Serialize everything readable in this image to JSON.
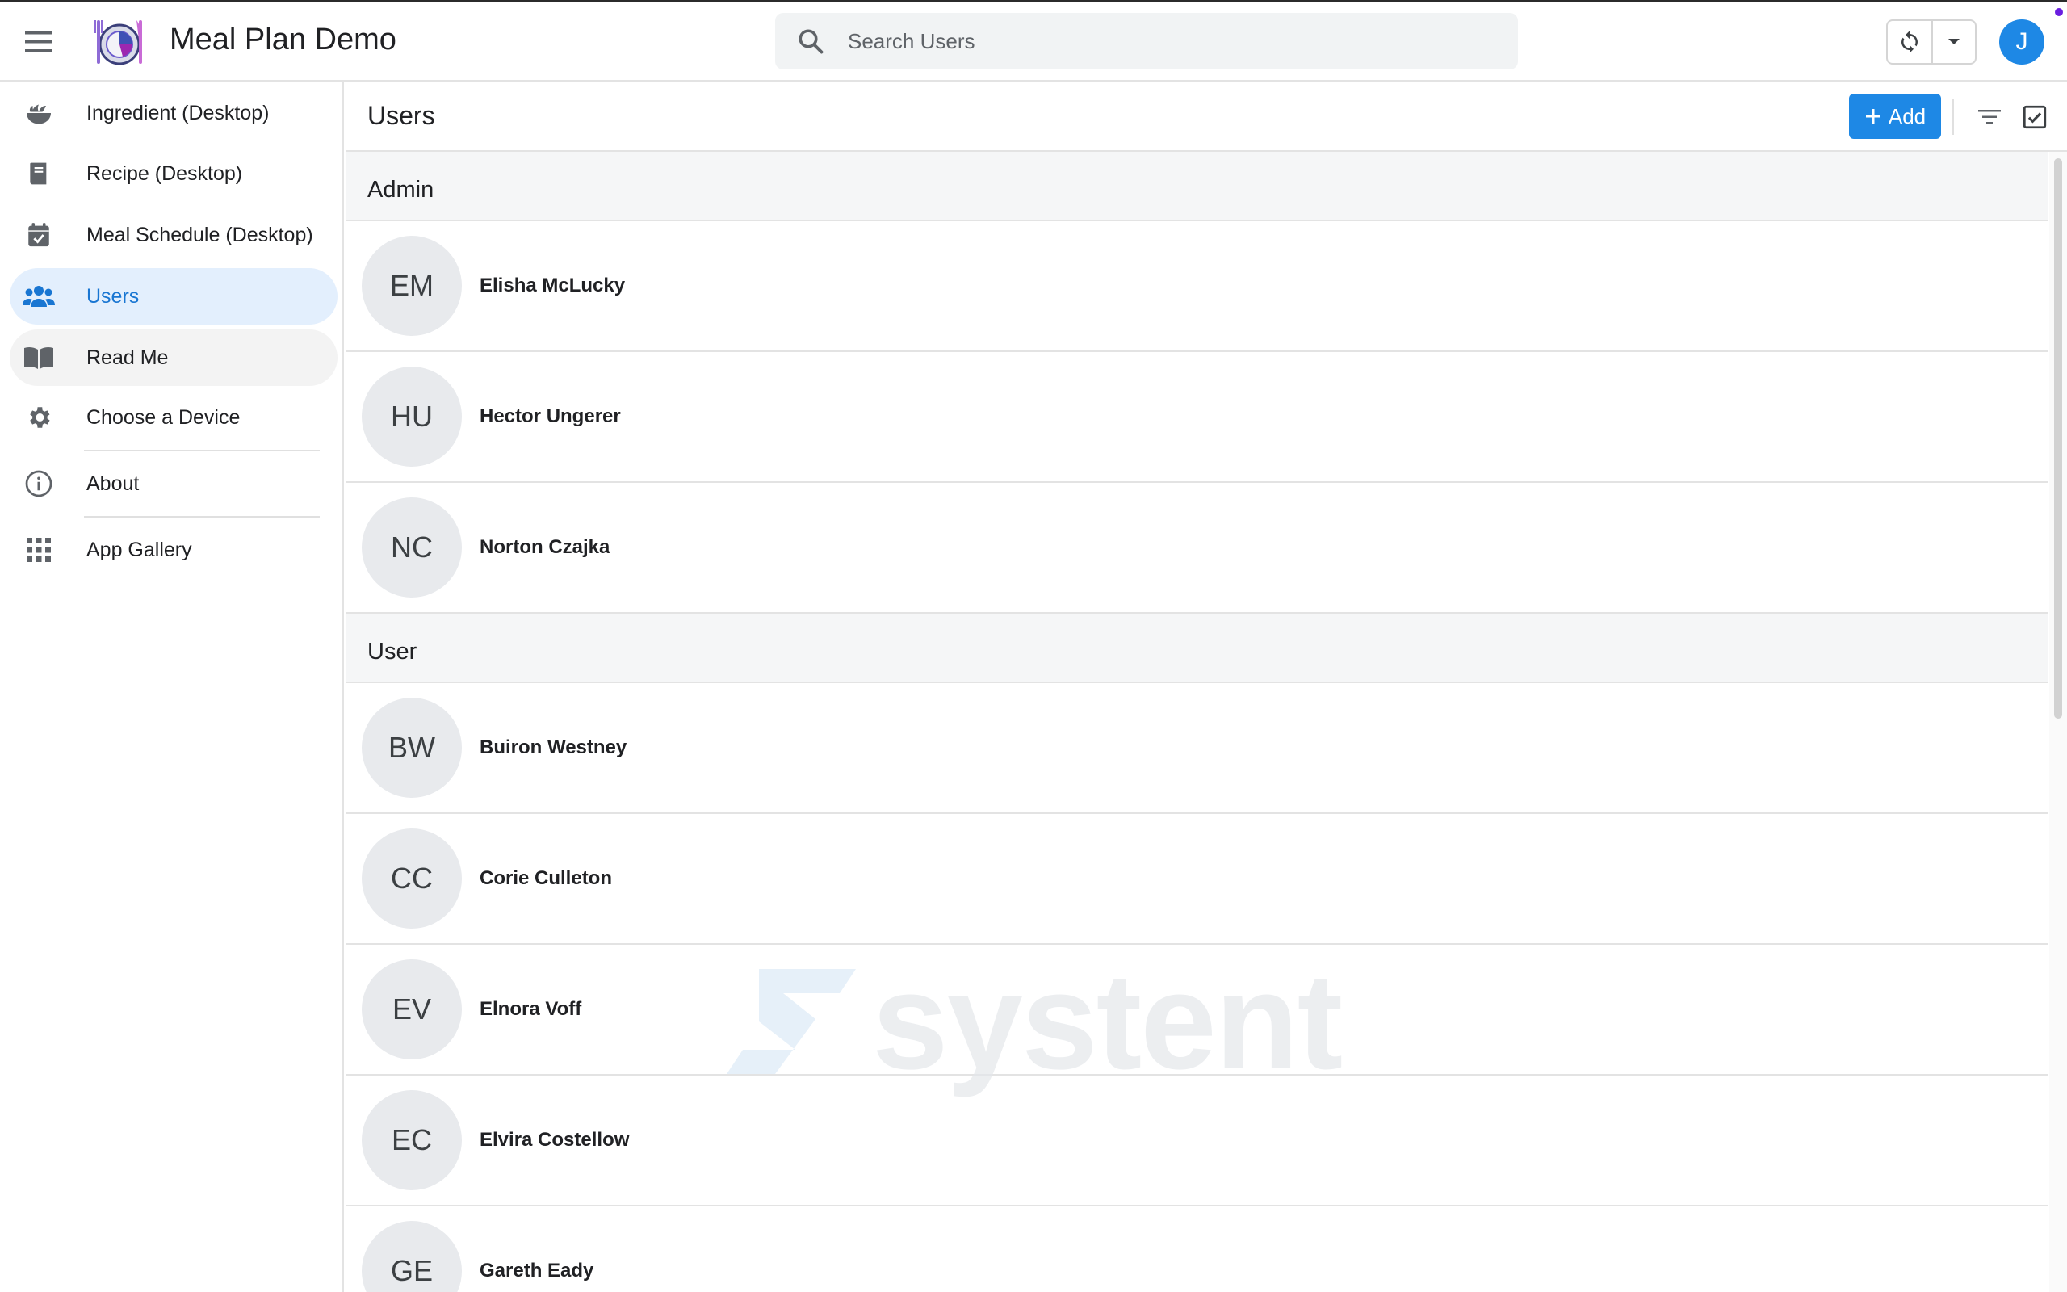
{
  "app": {
    "title": "Meal Plan Demo",
    "user_initial": "J"
  },
  "search": {
    "placeholder": "Search Users"
  },
  "sidebar": {
    "items": [
      {
        "label": "Ingredient (Desktop)",
        "icon": "bowl-icon"
      },
      {
        "label": "Recipe (Desktop)",
        "icon": "book-icon"
      },
      {
        "label": "Meal Schedule (Desktop)",
        "icon": "calendar-check-icon"
      },
      {
        "label": "Users",
        "icon": "users-icon",
        "active": true
      },
      {
        "label": "Read Me",
        "icon": "open-book-icon"
      },
      {
        "label": "Choose a Device",
        "icon": "gear-icon"
      },
      {
        "label": "About",
        "icon": "info-icon"
      },
      {
        "label": "App Gallery",
        "icon": "grid-icon"
      }
    ]
  },
  "main": {
    "title": "Users",
    "add_label": "Add",
    "groups": [
      {
        "name": "Admin",
        "users": [
          {
            "initials": "EM",
            "name": "Elisha McLucky"
          },
          {
            "initials": "HU",
            "name": "Hector Ungerer"
          },
          {
            "initials": "NC",
            "name": "Norton Czajka"
          }
        ]
      },
      {
        "name": "User",
        "users": [
          {
            "initials": "BW",
            "name": "Buiron Westney"
          },
          {
            "initials": "CC",
            "name": "Corie Culleton"
          },
          {
            "initials": "EV",
            "name": "Elnora Voff"
          },
          {
            "initials": "EC",
            "name": "Elvira Costellow"
          },
          {
            "initials": "GE",
            "name": "Gareth Eady"
          }
        ]
      }
    ]
  },
  "watermark": {
    "text": "systent"
  },
  "colors": {
    "accent": "#1e88e5",
    "active_bg": "#e3effd",
    "active_text": "#1976d2",
    "avatar_bg": "#e8eaed",
    "notification_dot": "#6a1de0"
  }
}
